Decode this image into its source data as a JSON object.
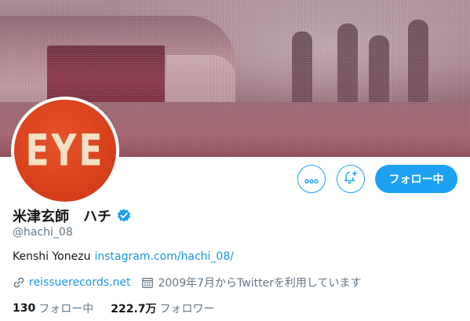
{
  "profile": {
    "avatar_text": "EYE",
    "display_name": "米津玄師　ハチ",
    "handle": "@hachi_08",
    "bio_text": "Kenshi Yonezu",
    "bio_link": "instagram.com/hachi_08/",
    "website": "reissuerecords.net",
    "joined": "2009年7月からTwitterを利用しています",
    "verified": true
  },
  "actions": {
    "more_icon": "more-dots-icon",
    "notify_icon": "bell-plus-icon",
    "follow_label": "フォロー中"
  },
  "stats": {
    "following_count": "130",
    "following_label": "フォロー中",
    "followers_count": "222.7万",
    "followers_label": "フォロワー"
  },
  "colors": {
    "accent": "#1da1f2",
    "link": "#1b95e0",
    "avatar_bg": "#d9401c",
    "avatar_text": "#f4e1c6"
  }
}
